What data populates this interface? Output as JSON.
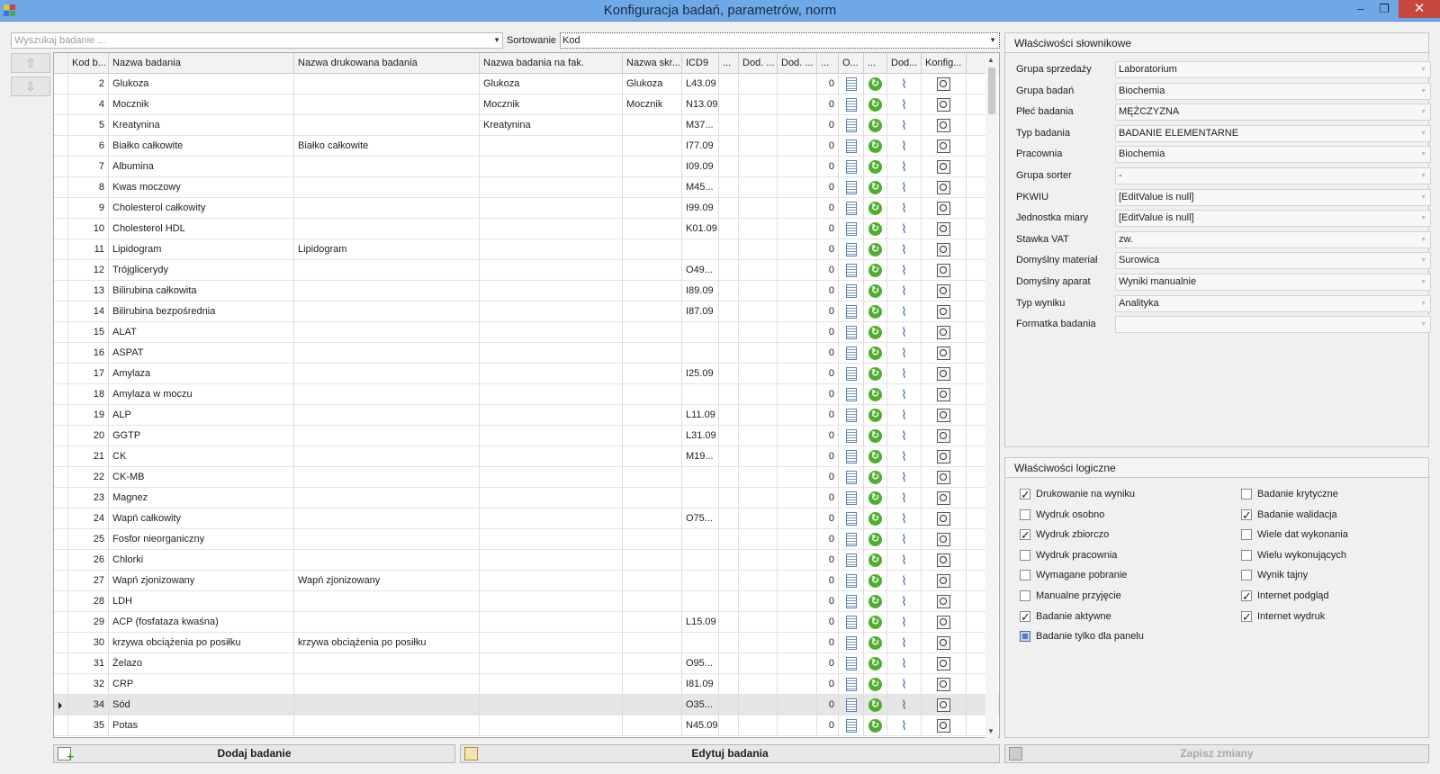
{
  "window": {
    "title": "Konfiguracja badań, parametrów, norm",
    "min_glyph": "–",
    "max_glyph": "❐",
    "close_glyph": "✕"
  },
  "search": {
    "placeholder": "Wyszukaj badanie ..."
  },
  "sorting": {
    "label": "Sortowanie",
    "value": "Kod"
  },
  "grid": {
    "columns": [
      "Kod b...",
      "Nazwa badania",
      "Nazwa drukowana badania",
      "Nazwa badania na fak.",
      "Nazwa skr...",
      "ICD9",
      "...",
      "Dod. ...",
      "Dod. ...",
      "...",
      "O...",
      "...",
      "Dod...",
      "Konfig..."
    ],
    "rows": [
      {
        "kod": "2",
        "nazwa": "Glukoza",
        "druk": "",
        "fak": "Glukoza",
        "skr": "Glukoza",
        "icd9": "L43.09",
        "o": "0"
      },
      {
        "kod": "4",
        "nazwa": "Mocznik",
        "druk": "",
        "fak": "Mocznik",
        "skr": "Mocznik",
        "icd9": "N13.09",
        "o": "0"
      },
      {
        "kod": "5",
        "nazwa": "Kreatynina",
        "druk": "",
        "fak": "Kreatynina",
        "skr": "",
        "icd9": "M37...",
        "o": "0"
      },
      {
        "kod": "6",
        "nazwa": "Białko całkowite",
        "druk": "Białko całkowite",
        "fak": "",
        "skr": "",
        "icd9": "I77.09",
        "o": "0"
      },
      {
        "kod": "7",
        "nazwa": "Albumina",
        "druk": "",
        "fak": "",
        "skr": "",
        "icd9": "I09.09",
        "o": "0"
      },
      {
        "kod": "8",
        "nazwa": "Kwas moczowy",
        "druk": "",
        "fak": "",
        "skr": "",
        "icd9": "M45...",
        "o": "0"
      },
      {
        "kod": "9",
        "nazwa": "Cholesterol całkowity",
        "druk": "",
        "fak": "",
        "skr": "",
        "icd9": "I99.09",
        "o": "0"
      },
      {
        "kod": "10",
        "nazwa": "Cholesterol HDL",
        "druk": "",
        "fak": "",
        "skr": "",
        "icd9": "K01.09",
        "o": "0"
      },
      {
        "kod": "11",
        "nazwa": "Lipidogram",
        "druk": "Lipidogram",
        "fak": "",
        "skr": "",
        "icd9": "",
        "o": "0"
      },
      {
        "kod": "12",
        "nazwa": "Trójglicerydy",
        "druk": "",
        "fak": "",
        "skr": "",
        "icd9": "O49...",
        "o": "0"
      },
      {
        "kod": "13",
        "nazwa": "Bilirubina całkowita",
        "druk": "",
        "fak": "",
        "skr": "",
        "icd9": "I89.09",
        "o": "0"
      },
      {
        "kod": "14",
        "nazwa": "Bilirubina bezpośrednia",
        "druk": "",
        "fak": "",
        "skr": "",
        "icd9": "I87.09",
        "o": "0"
      },
      {
        "kod": "15",
        "nazwa": "ALAT",
        "druk": "",
        "fak": "",
        "skr": "",
        "icd9": "",
        "o": "0"
      },
      {
        "kod": "16",
        "nazwa": "ASPAT",
        "druk": "",
        "fak": "",
        "skr": "",
        "icd9": "",
        "o": "0"
      },
      {
        "kod": "17",
        "nazwa": "Amylaza",
        "druk": "",
        "fak": "",
        "skr": "",
        "icd9": "I25.09",
        "o": "0"
      },
      {
        "kod": "18",
        "nazwa": "Amylaza w moczu",
        "druk": "",
        "fak": "",
        "skr": "",
        "icd9": "",
        "o": "0"
      },
      {
        "kod": "19",
        "nazwa": "ALP",
        "druk": "",
        "fak": "",
        "skr": "",
        "icd9": "L11.09",
        "o": "0"
      },
      {
        "kod": "20",
        "nazwa": "GGTP",
        "druk": "",
        "fak": "",
        "skr": "",
        "icd9": "L31.09",
        "o": "0"
      },
      {
        "kod": "21",
        "nazwa": "CK",
        "druk": "",
        "fak": "",
        "skr": "",
        "icd9": "M19...",
        "o": "0"
      },
      {
        "kod": "22",
        "nazwa": "CK-MB",
        "druk": "",
        "fak": "",
        "skr": "",
        "icd9": "",
        "o": "0"
      },
      {
        "kod": "23",
        "nazwa": "Magnez",
        "druk": "",
        "fak": "",
        "skr": "",
        "icd9": "",
        "o": "0"
      },
      {
        "kod": "24",
        "nazwa": "Wapń całkowity",
        "druk": "",
        "fak": "",
        "skr": "",
        "icd9": "O75...",
        "o": "0"
      },
      {
        "kod": "25",
        "nazwa": "Fosfor nieorganiczny",
        "druk": "",
        "fak": "",
        "skr": "",
        "icd9": "",
        "o": "0"
      },
      {
        "kod": "26",
        "nazwa": "Chlorki",
        "druk": "",
        "fak": "",
        "skr": "",
        "icd9": "",
        "o": "0"
      },
      {
        "kod": "27",
        "nazwa": "Wapń zjonizowany",
        "druk": "Wapń zjonizowany",
        "fak": "",
        "skr": "",
        "icd9": "",
        "o": "0"
      },
      {
        "kod": "28",
        "nazwa": "LDH",
        "druk": "",
        "fak": "",
        "skr": "",
        "icd9": "",
        "o": "0"
      },
      {
        "kod": "29",
        "nazwa": "ACP (fosfataza kwaśna)",
        "druk": "",
        "fak": "",
        "skr": "",
        "icd9": "L15.09",
        "o": "0"
      },
      {
        "kod": "30",
        "nazwa": "krzywa obciążenia po posiłku",
        "druk": "krzywa obciążenia po posiłku",
        "fak": "",
        "skr": "",
        "icd9": "",
        "o": "0"
      },
      {
        "kod": "31",
        "nazwa": "Żelazo",
        "druk": "",
        "fak": "",
        "skr": "",
        "icd9": "O95...",
        "o": "0"
      },
      {
        "kod": "32",
        "nazwa": "CRP",
        "druk": "",
        "fak": "",
        "skr": "",
        "icd9": "I81.09",
        "o": "0"
      },
      {
        "kod": "34",
        "nazwa": "Sód",
        "druk": "",
        "fak": "",
        "skr": "",
        "icd9": "O35...",
        "o": "0",
        "selected": true
      },
      {
        "kod": "35",
        "nazwa": "Potas",
        "druk": "",
        "fak": "",
        "skr": "",
        "icd9": "N45.09",
        "o": "0"
      }
    ]
  },
  "buttons": {
    "add": "Dodaj badanie",
    "edit": "Edytuj badania",
    "save": "Zapisz zmiany"
  },
  "dict_panel": {
    "title": "Właściwości słownikowe",
    "rows": [
      {
        "label": "Grupa sprzedaży",
        "value": "Laboratorium"
      },
      {
        "label": "Grupa badań",
        "value": "Biochemia"
      },
      {
        "label": "Płeć badania",
        "value": "MĘŻCZYZNA"
      },
      {
        "label": "Typ badania",
        "value": "BADANIE ELEMENTARNE"
      },
      {
        "label": "Pracownia",
        "value": "Biochemia"
      },
      {
        "label": "Grupa sorter",
        "value": "-"
      },
      {
        "label": "PKWIU",
        "value": "[EditValue is null]"
      },
      {
        "label": "Jednostka miary",
        "value": "[EditValue is null]"
      },
      {
        "label": "Stawka VAT",
        "value": "zw."
      },
      {
        "label": "Domyślny materiał",
        "value": "Surowica"
      },
      {
        "label": "Domyślny aparat",
        "value": "Wyniki manualnie"
      },
      {
        "label": "Typ wyniku",
        "value": "Analityka"
      },
      {
        "label": "Formatka badania",
        "value": ""
      }
    ]
  },
  "logic_panel": {
    "title": "Właściwości logiczne",
    "left": [
      {
        "label": "Drukowanie na wyniku",
        "checked": true
      },
      {
        "label": "Wydruk osobno",
        "checked": false
      },
      {
        "label": "Wydruk zbiorczo",
        "checked": true
      },
      {
        "label": "Wydruk pracownia",
        "checked": false
      },
      {
        "label": "Wymagane pobranie",
        "checked": false
      },
      {
        "label": "Manualne przyjęcie",
        "checked": false
      },
      {
        "label": "Badanie aktywne",
        "checked": true
      },
      {
        "label": "Badanie tylko dla panelu",
        "checked": "indeterminate"
      }
    ],
    "right": [
      {
        "label": "Badanie krytyczne",
        "checked": false
      },
      {
        "label": "Badanie walidacja",
        "checked": true
      },
      {
        "label": "Wiele dat wykonania",
        "checked": false
      },
      {
        "label": "Wielu wykonujących",
        "checked": false
      },
      {
        "label": "Wynik tajny",
        "checked": false
      },
      {
        "label": "Internet podgląd",
        "checked": true
      },
      {
        "label": "Internet wydruk",
        "checked": true
      }
    ]
  },
  "icons": [
    "app-icon",
    "dropdown-arrow-icon",
    "arrow-up-icon",
    "arrow-down-icon",
    "document-icon",
    "refresh-icon",
    "paperclip-icon",
    "config-search-icon",
    "add-icon",
    "edit-icon",
    "save-icon"
  ]
}
